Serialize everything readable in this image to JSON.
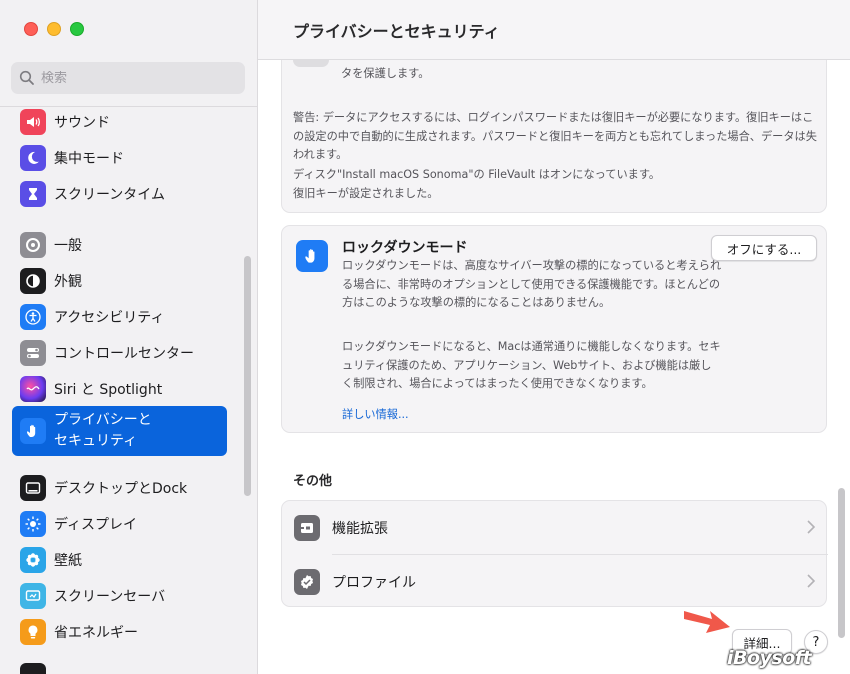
{
  "window": {
    "title": "プライバシーとセキュリティ"
  },
  "search": {
    "placeholder": "検索"
  },
  "sidebar": {
    "items": [
      {
        "label": "サウンド",
        "icon": "speaker-icon",
        "color": "#f0445a"
      },
      {
        "label": "集中モード",
        "icon": "moon-icon",
        "color": "#5a4ee6"
      },
      {
        "label": "スクリーンタイム",
        "icon": "hourglass-icon",
        "color": "#5a4ee6"
      },
      {
        "label": "一般",
        "icon": "gear-icon",
        "color": "#8e8d93"
      },
      {
        "label": "外観",
        "icon": "appearance-icon",
        "color": "#1d1d1f"
      },
      {
        "label": "アクセシビリティ",
        "icon": "accessibility-icon",
        "color": "#1f7cf5"
      },
      {
        "label": "コントロールセンター",
        "icon": "control-center-icon",
        "color": "#8e8d93"
      },
      {
        "label": "Siri と Spotlight",
        "icon": "siri-icon",
        "color": "#3a2a6a"
      },
      {
        "label": "プライバシーと\nセキュリティ",
        "icon": "hand-icon",
        "color": "#1f7cf5"
      },
      {
        "label": "デスクトップとDock",
        "icon": "dock-icon",
        "color": "#1d1d1f"
      },
      {
        "label": "ディスプレイ",
        "icon": "brightness-icon",
        "color": "#1f7cf5"
      },
      {
        "label": "壁紙",
        "icon": "wallpaper-icon",
        "color": "#2aa5e8"
      },
      {
        "label": "スクリーンセーバ",
        "icon": "screensaver-icon",
        "color": "#3fb5e6"
      },
      {
        "label": "省エネルギー",
        "icon": "lightbulb-icon",
        "color": "#f59b1a"
      }
    ]
  },
  "filevault": {
    "text1": "タを保護します。",
    "warning": "警告: データにアクセスするには、ログインパスワードまたは復旧キーが必要になります。復旧キーはこの設定の中で自動的に生成されます。パスワードと復旧キーを両方とも忘れてしまった場合、データは失われます。",
    "status": "ディスク\"Install macOS Sonoma\"の FileVault はオンになっています。\n復旧キーが設定されました。"
  },
  "lockdown": {
    "title": "ロックダウンモード",
    "desc1": "ロックダウンモードは、高度なサイバー攻撃の標的になっていると考えられる場合に、非常時のオプションとして使用できる保護機能です。ほとんどの方はこのような攻撃の標的になることはありません。",
    "desc2": "ロックダウンモードになると、Macは通常通りに機能しなくなります。セキュリティ保護のため、アプリケーション、Webサイト、および機能は厳しく制限され、場合によってはまったく使用できなくなります。",
    "link": "詳しい情報...",
    "button": "オフにする..."
  },
  "others": {
    "title": "その他",
    "rows": [
      {
        "label": "機能拡張",
        "icon": "extensions-icon"
      },
      {
        "label": "プロファイル",
        "icon": "profile-checkmark-icon"
      }
    ]
  },
  "footer": {
    "details_button": "詳細...",
    "help_button": "?"
  },
  "watermark": "iBoysoft",
  "colors": {
    "accent": "#0a64dc",
    "link": "#1466d6",
    "arrow": "#f0584a"
  }
}
